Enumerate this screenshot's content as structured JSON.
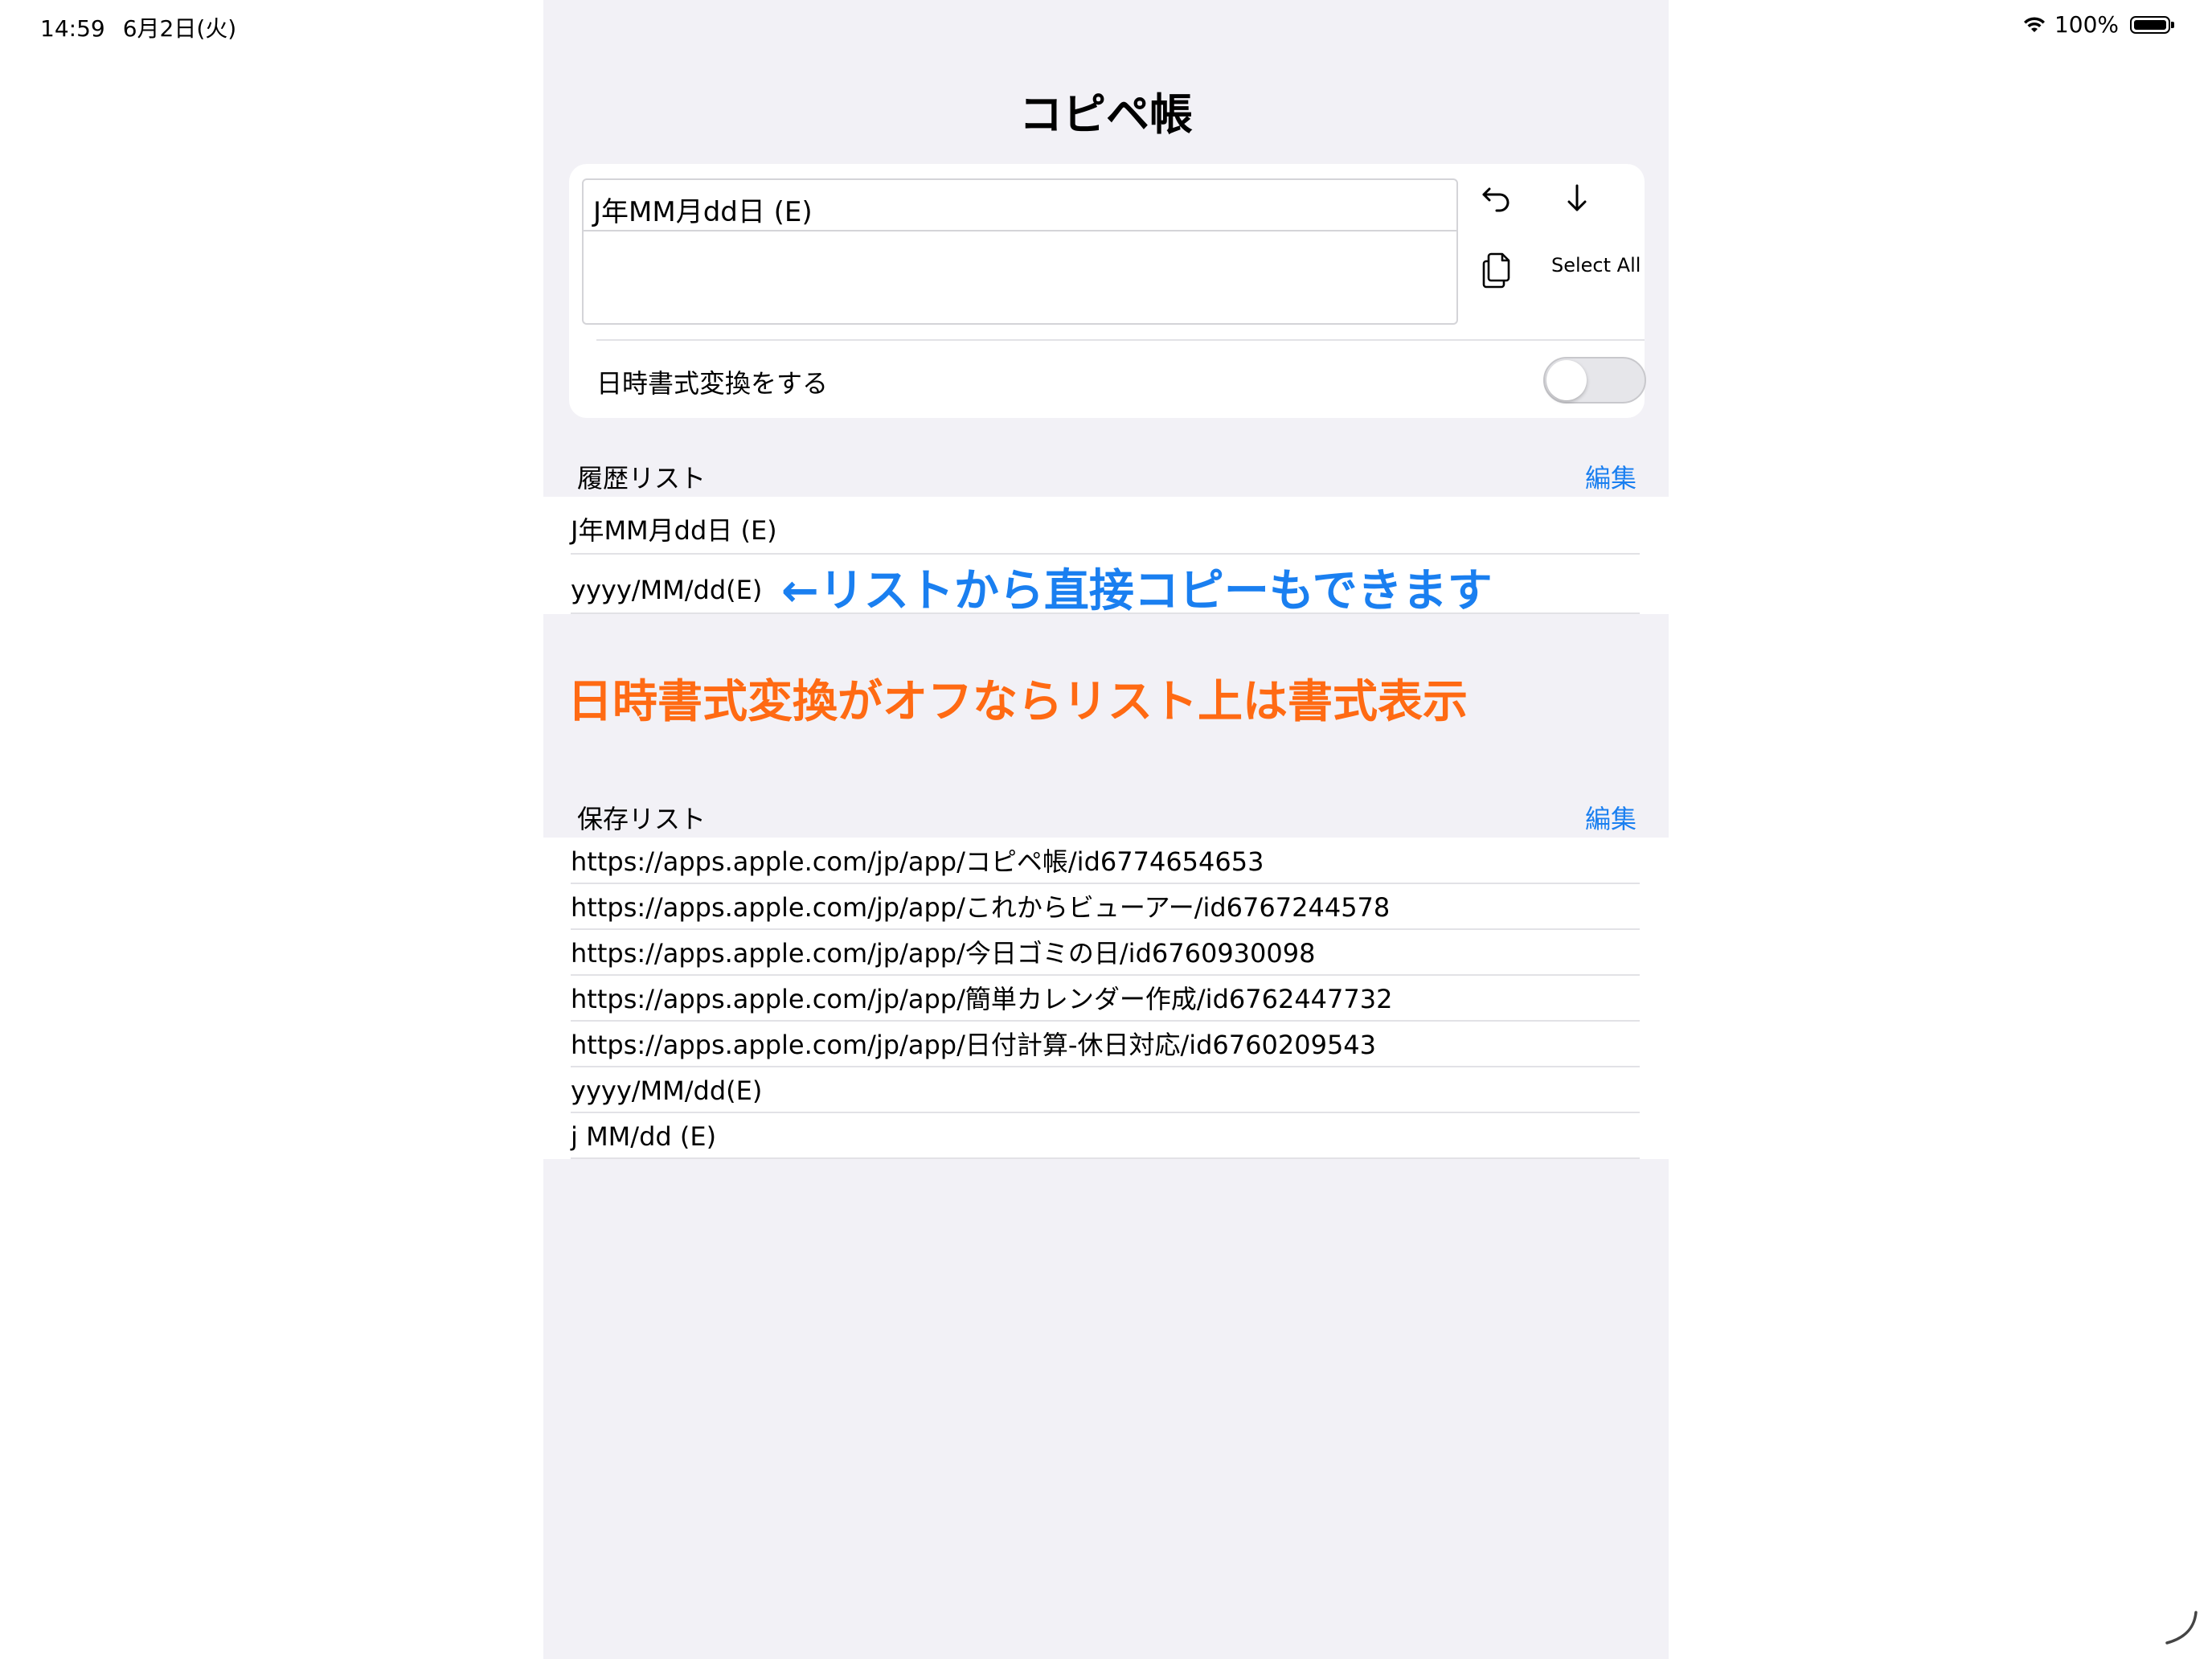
{
  "status_bar": {
    "time": "14:59",
    "date": "6月2日(火)",
    "battery": "100%"
  },
  "nav": {
    "title": "コピペ帳"
  },
  "editor": {
    "text_value": "J年MM月dd日 (E)",
    "select_all_label": "Select All",
    "toggle_label": "日時書式変換をする",
    "toggle_on": false
  },
  "history": {
    "header": "履歴リスト",
    "edit_label": "編集",
    "items": [
      "J年MM月dd日 (E)",
      "yyyy/MM/dd(E)"
    ]
  },
  "saved": {
    "header": "保存リスト",
    "edit_label": "編集",
    "items": [
      "https://apps.apple.com/jp/app/コピペ帳/id6774654653",
      "https://apps.apple.com/jp/app/これからビューアー/id6767244578",
      "https://apps.apple.com/jp/app/今日ゴミの日/id6760930098",
      "https://apps.apple.com/jp/app/簡単カレンダー作成/id6762447732",
      "https://apps.apple.com/jp/app/日付計算-休日対応/id6760209543",
      "yyyy/MM/dd(E)",
      "j MM/dd (E)"
    ]
  },
  "annotations": {
    "blue": "←リストから直接コピーもできます",
    "orange": "日時書式変換がオフならリスト上は書式表示"
  },
  "colors": {
    "accent": "#1a7ff0",
    "annotation_orange": "#ff6a13",
    "panel_background": "#f2f1f6"
  },
  "icons": [
    "wifi-icon",
    "battery-icon",
    "undo-icon",
    "arrow-down-icon",
    "copy-icon",
    "corner-indicator-icon"
  ]
}
